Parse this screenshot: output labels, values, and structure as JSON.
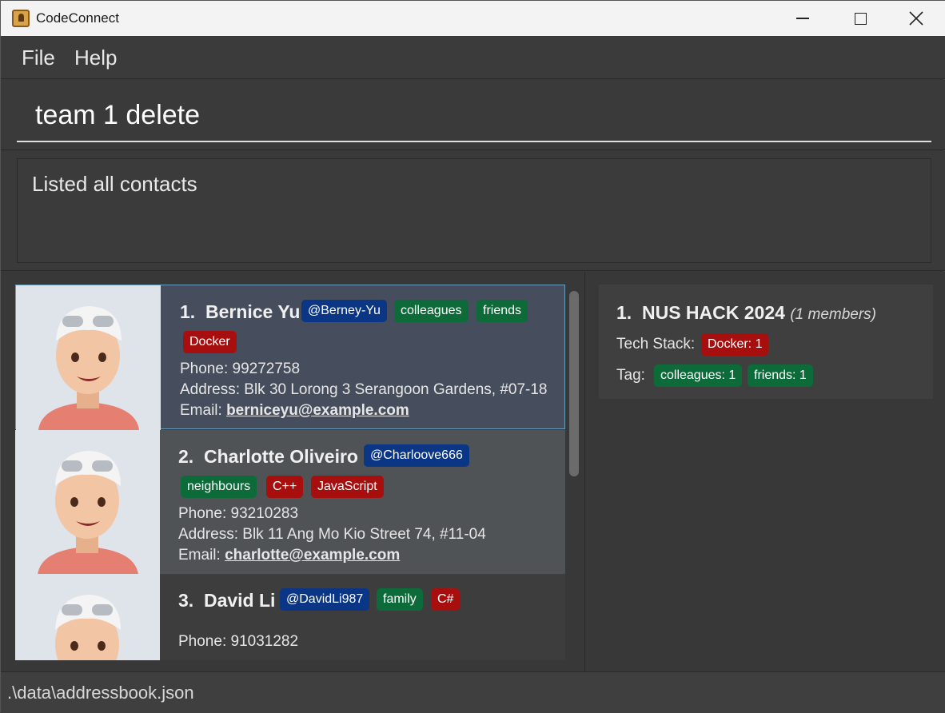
{
  "window": {
    "title": "CodeConnect"
  },
  "menu": {
    "file": "File",
    "help": "Help"
  },
  "command": {
    "value": "team 1 delete"
  },
  "result": {
    "text": "Listed all contacts"
  },
  "persons": [
    {
      "index": "1.",
      "name": "Bernice Yu",
      "handle": "@Berney-Yu",
      "tags": [
        "colleagues",
        "friends"
      ],
      "tech": [
        "Docker"
      ],
      "phone_label": "Phone:",
      "phone": "99272758",
      "address_label": "Address:",
      "address": "Blk 30 Lorong 3 Serangoon Gardens, #07-18",
      "email_label": "Email:",
      "email": "berniceyu@example.com"
    },
    {
      "index": "2.",
      "name": "Charlotte Oliveiro",
      "handle": "@Charloove666",
      "tags": [
        "neighbours"
      ],
      "tech": [
        "C++",
        "JavaScript"
      ],
      "phone_label": "Phone:",
      "phone": "93210283",
      "address_label": "Address:",
      "address": "Blk 11 Ang Mo Kio Street 74, #11-04",
      "email_label": "Email:",
      "email": "charlotte@example.com"
    },
    {
      "index": "3.",
      "name": "David Li",
      "handle": "@DavidLi987",
      "tags": [
        "family"
      ],
      "tech": [
        "C#"
      ],
      "phone_label": "Phone:",
      "phone": "91031282"
    }
  ],
  "team": {
    "index": "1.",
    "name": "NUS HACK 2024",
    "members": "(1 members)",
    "tech_label": "Tech Stack:",
    "tech": [
      "Docker: 1"
    ],
    "tag_label": "Tag:",
    "tags": [
      "colleagues: 1",
      "friends: 1"
    ]
  },
  "status": {
    "path": ".\\data\\addressbook.json"
  },
  "colors": {
    "handle": "#0b3585",
    "tag": "#0d6b3a",
    "tech": "#a70f0f",
    "selected_border": "#6a9cbf"
  }
}
